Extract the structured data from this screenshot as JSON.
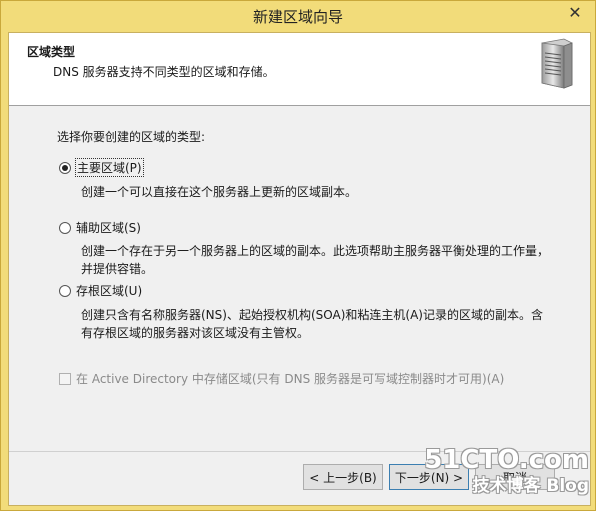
{
  "window": {
    "title": "新建区域向导",
    "close_glyph": "✕"
  },
  "header": {
    "title": "区域类型",
    "description": "DNS 服务器支持不同类型的区域和存储。",
    "icon": "server-icon"
  },
  "main": {
    "prompt": "选择你要创建的区域的类型:",
    "options": [
      {
        "label": "主要区域(P)",
        "checked": true,
        "description": "创建一个可以直接在这个服务器上更新的区域副本。"
      },
      {
        "label": "辅助区域(S)",
        "checked": false,
        "description": "创建一个存在于另一个服务器上的区域的副本。此选项帮助主服务器平衡处理的工作量，并提供容错。"
      },
      {
        "label": "存根区域(U)",
        "checked": false,
        "description": "创建只含有名称服务器(NS)、起始授权机构(SOA)和粘连主机(A)记录的区域的副本。含有存根区域的服务器对该区域没有主管权。"
      }
    ],
    "ad_checkbox": {
      "label": "在 Active Directory 中存储区域(只有 DNS 服务器是可写域控制器时才可用)(A)",
      "checked": false,
      "enabled": false
    }
  },
  "footer": {
    "back_label": "< 上一步(B)",
    "next_label": "下一步(N) >",
    "cancel_label": "取消"
  },
  "watermark": {
    "line1": "51CTO.com",
    "line2": "技术博客 Blog"
  },
  "colors": {
    "titlebar": "#f2dc7a",
    "dialog_bg": "#f0f0f0",
    "header_bg": "#ffffff",
    "accent_border": "#3c7fb1"
  }
}
